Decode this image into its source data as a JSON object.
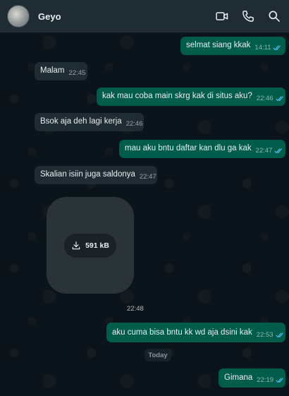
{
  "header": {
    "contact_name": "Geyo",
    "icons": [
      "video-call-icon",
      "voice-call-icon",
      "search-icon"
    ]
  },
  "colors": {
    "header_bg": "#1f2c33",
    "chat_bg": "#0b141a",
    "outgoing_bubble": "#005c4b",
    "incoming_bubble": "#202c33",
    "read_ticks": "#53bdeb"
  },
  "messages": [
    {
      "direction": "out",
      "text": "selmat siang kkak",
      "time": "14:11",
      "status": "read"
    },
    {
      "direction": "in",
      "text": "Malam",
      "time": "22:45"
    },
    {
      "direction": "out",
      "text": "kak mau coba main skrg kak di situs aku?",
      "time": "22:46",
      "status": "read"
    },
    {
      "direction": "in",
      "text": "Bsok aja deh lagi kerja",
      "time": "22:46"
    },
    {
      "direction": "out",
      "text": "mau aku bntu daftar kan dlu ga kak",
      "time": "22:47",
      "status": "read"
    },
    {
      "direction": "in",
      "text": "Skalian isiin juga saldonya",
      "time": "22:47"
    },
    {
      "direction": "out",
      "text": "aku cuma bisa bntu kk wd aja dsini kak",
      "time": "22:53",
      "status": "read"
    },
    {
      "direction": "out",
      "text": "Gimana",
      "time": "22:19",
      "status": "read"
    }
  ],
  "media": {
    "download_size": "591 kB",
    "time": "22:48"
  },
  "day_divider": "Today"
}
